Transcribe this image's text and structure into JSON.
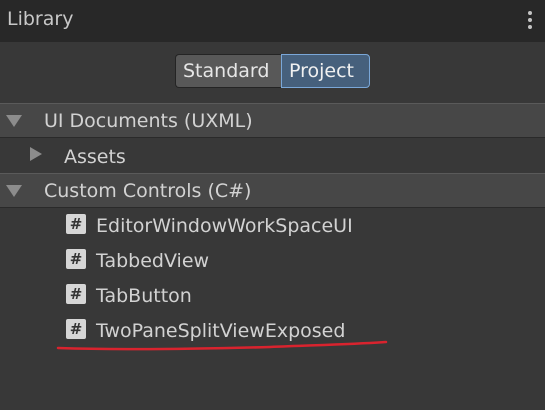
{
  "panel": {
    "title": "Library",
    "menu_icon": "kebab-menu-icon"
  },
  "toggle": {
    "options": [
      "Standard",
      "Project"
    ],
    "selected": "Project"
  },
  "tree": {
    "sections": [
      {
        "label": "UI Documents (UXML)",
        "expanded": true
      },
      {
        "label": "Custom Controls (C#)",
        "expanded": true
      }
    ],
    "assets_folder": {
      "label": "Assets",
      "expanded": false
    },
    "controls": [
      {
        "label": "EditorWindowWorkSpaceUI",
        "icon": "csharp-script-icon",
        "icon_glyph": "#"
      },
      {
        "label": "TabbedView",
        "icon": "csharp-script-icon",
        "icon_glyph": "#"
      },
      {
        "label": "TabButton",
        "icon": "csharp-script-icon",
        "icon_glyph": "#"
      },
      {
        "label": "TwoPaneSplitViewExposed",
        "icon": "csharp-script-icon",
        "icon_glyph": "#"
      }
    ]
  },
  "annotation": {
    "underline_color": "#d9232e"
  },
  "colors": {
    "background": "#383838",
    "header": "#282828",
    "selected_toggle": "#46607c",
    "selected_toggle_border": "#7aa7d8"
  }
}
